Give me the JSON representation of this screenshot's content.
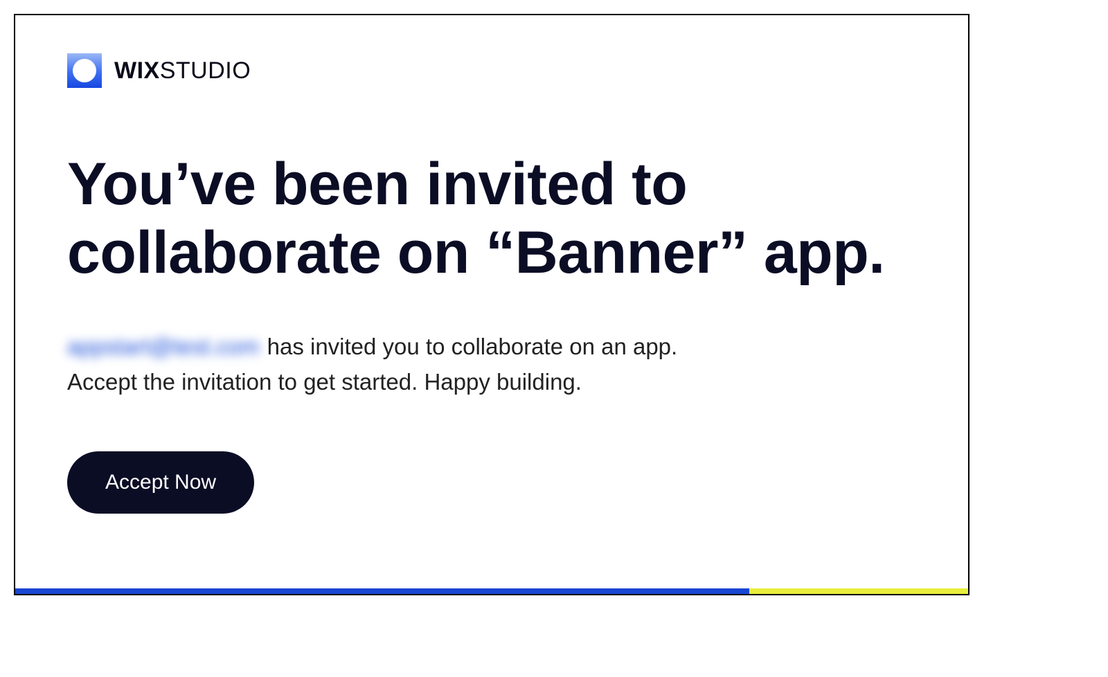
{
  "logo": {
    "brand_bold": "WIX",
    "brand_light": "STUDIO"
  },
  "headline": "You’ve been invited to collaborate on “Banner” app.",
  "body": {
    "sender_email": "appstart@test.com",
    "line1_tail": " has invited you to collaborate on an app.",
    "line2": "Accept the invitation to get started. Happy building."
  },
  "cta": {
    "label": "Accept Now"
  }
}
